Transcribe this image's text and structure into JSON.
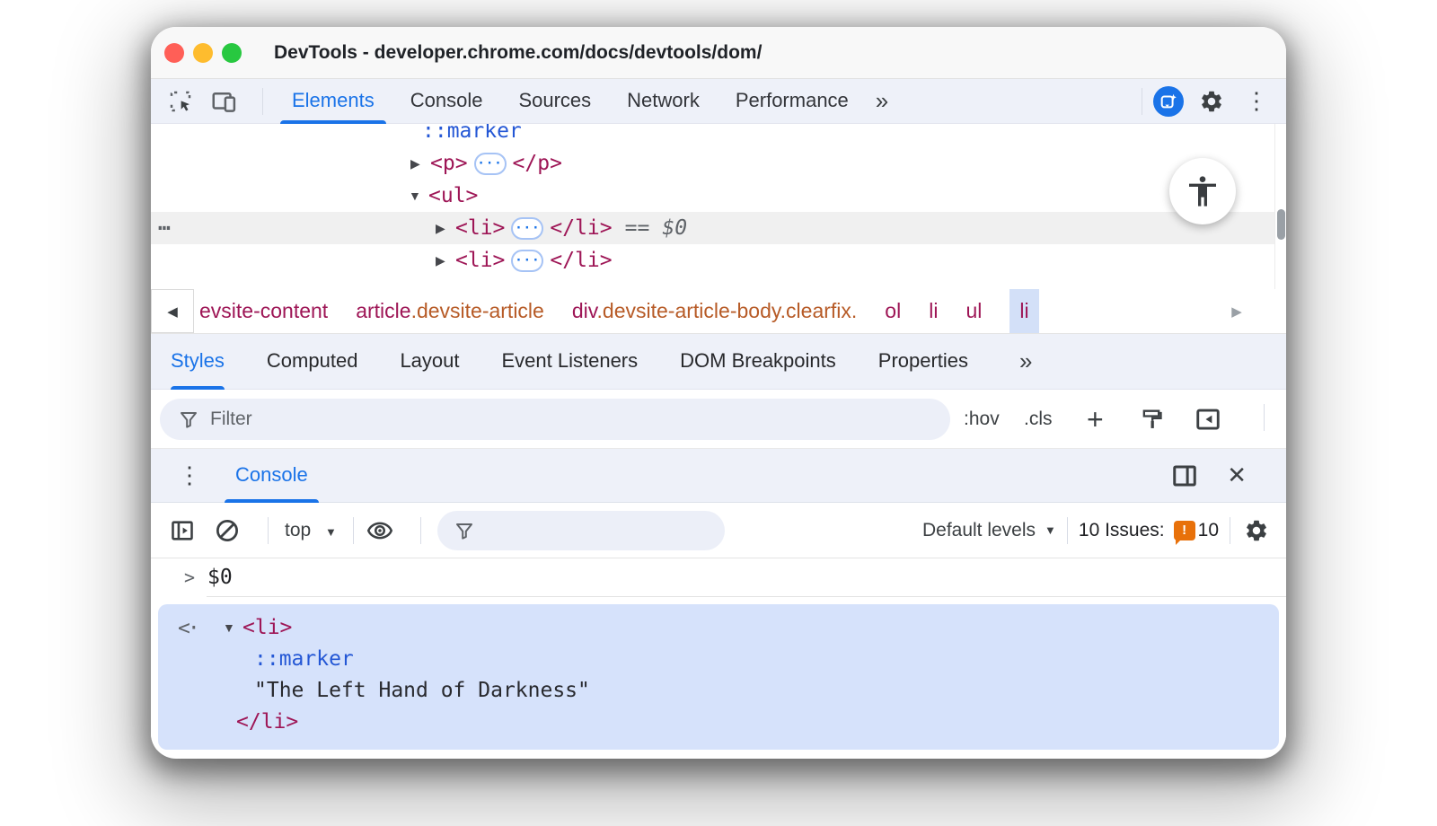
{
  "window": {
    "title": "DevTools - developer.chrome.com/docs/devtools/dom/"
  },
  "toolbar": {
    "tabs": [
      "Elements",
      "Console",
      "Sources",
      "Network",
      "Performance"
    ],
    "active_tab": "Elements"
  },
  "icons": {
    "more": "»",
    "kebab": "⋮",
    "close": "✕",
    "back": "◀",
    "forward": "▶",
    "expand_closed": "▶",
    "expand_open": "▼",
    "dropdown": "▼",
    "plus": "+",
    "prompt": ">",
    "result_marker": "<·",
    "overflow_dots": "⋯",
    "pill_dots": "···"
  },
  "elements_panel": {
    "rows": {
      "marker": "::marker",
      "p_open": "<p>",
      "p_close": "</p>",
      "ul_open": "<ul>",
      "li1_open": "<li>",
      "li1_close": "</li>",
      "eq": "==",
      "dollar": "$0",
      "li2_open": "<li>",
      "li2_close": "</li>"
    }
  },
  "breadcrumb": {
    "crumbs": [
      {
        "tag": "evsite-content",
        "classes": ""
      },
      {
        "tag": "article",
        "classes": ".devsite-article"
      },
      {
        "tag": "div",
        "classes": ".devsite-article-body.clearfix."
      },
      {
        "tag": "ol",
        "classes": ""
      },
      {
        "tag": "li",
        "classes": ""
      },
      {
        "tag": "ul",
        "classes": ""
      },
      {
        "tag": "li",
        "classes": "",
        "selected": true
      }
    ]
  },
  "styles_panel": {
    "tabs": [
      "Styles",
      "Computed",
      "Layout",
      "Event Listeners",
      "DOM Breakpoints",
      "Properties"
    ],
    "active_tab": "Styles",
    "filter_placeholder": "Filter",
    "hov": ":hov",
    "cls": ".cls"
  },
  "console": {
    "tab": "Console",
    "context": "top",
    "levels_label": "Default levels",
    "issues_label": "10 Issues:",
    "issues_badge": "!",
    "issues_count": "10",
    "input_echo": "$0",
    "result": {
      "tag_open": "<li>",
      "pseudo": "::marker",
      "text": "\"The Left Hand of Darkness\"",
      "tag_close": "</li>"
    }
  },
  "colors": {
    "accent_blue": "#1a73e8",
    "tag_maroon": "#9e1656",
    "class_orange": "#b75b27",
    "pseudo_blue": "#2457d5",
    "issues_orange": "#e8710a",
    "result_highlight_bg": "#d6e2fb",
    "selected_crumb_bg": "#d3e0f8",
    "dom_row_highlight": "#f0f0f0",
    "toolbar_bg": "#eef1f9",
    "traffic_red": "#ff5f57",
    "traffic_yellow": "#febc2e",
    "traffic_green": "#28c840"
  }
}
